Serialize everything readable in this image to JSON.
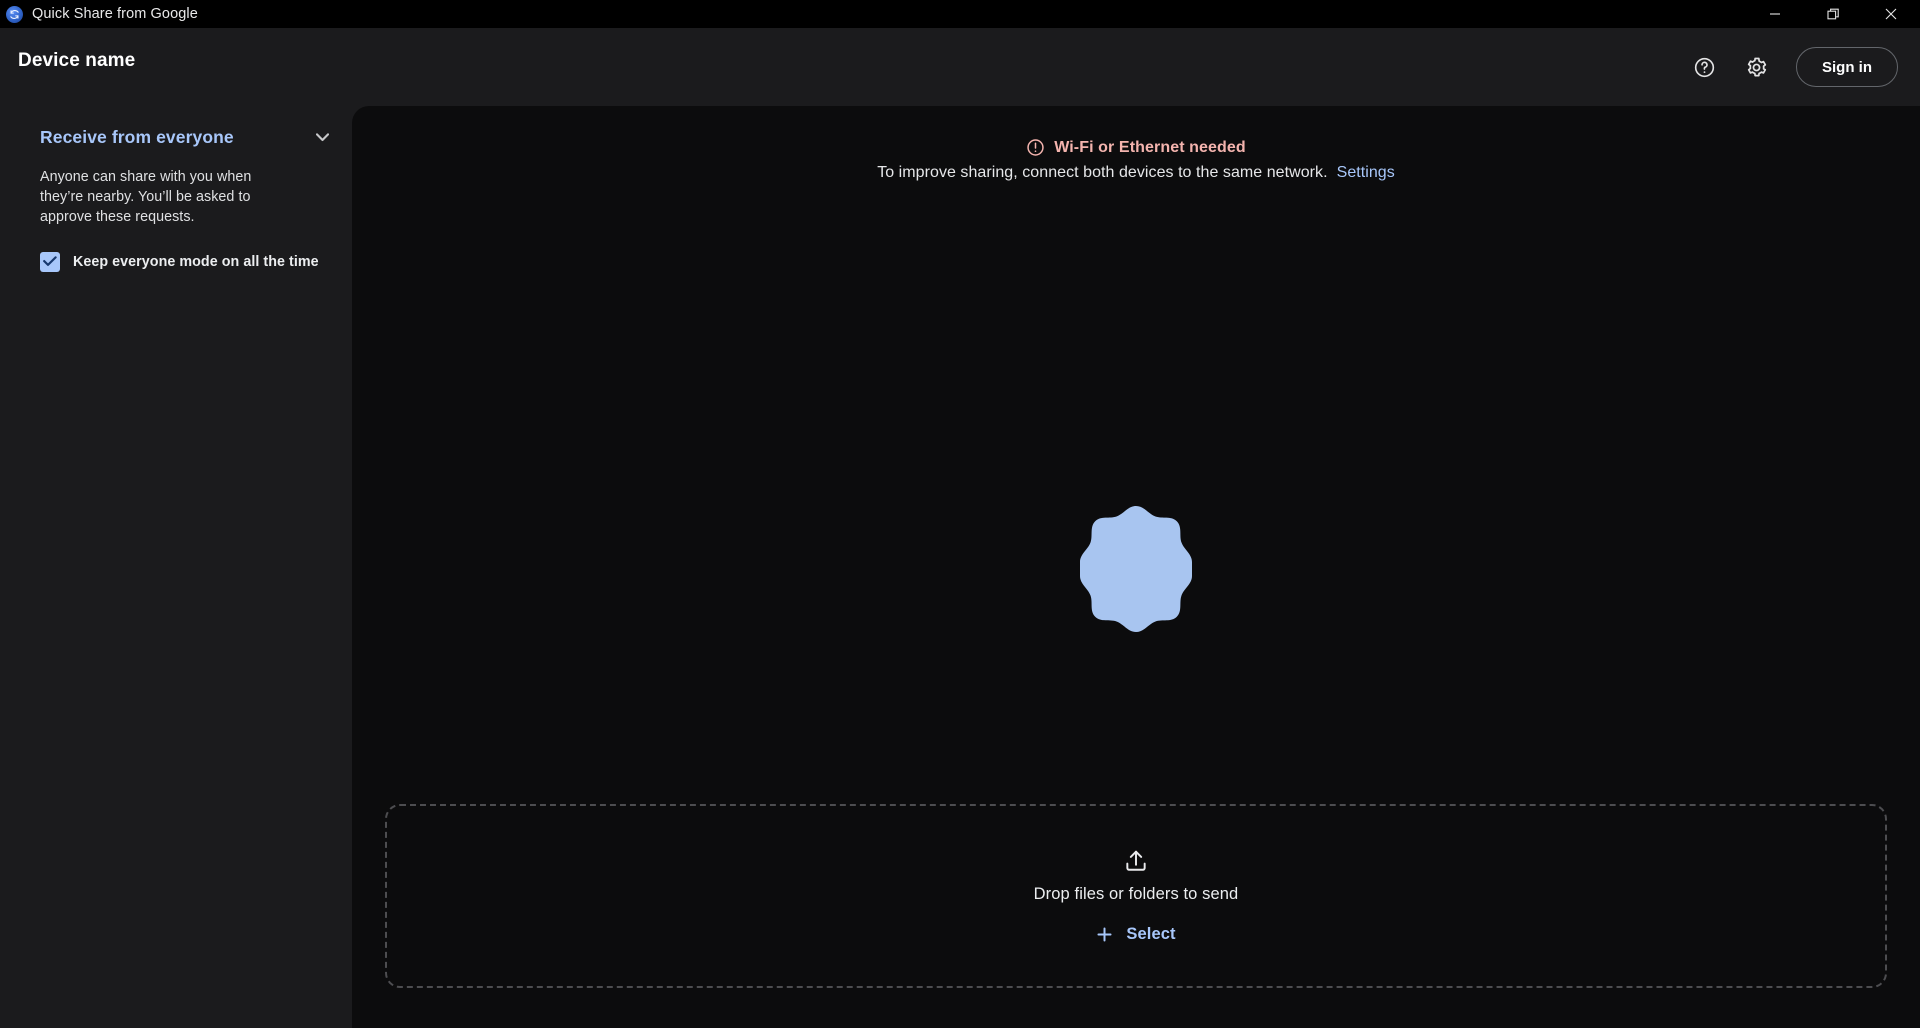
{
  "window": {
    "title": "Quick Share from Google",
    "logo_icon": "quick-share-logo-icon",
    "controls": {
      "minimize": "minimize-icon",
      "maximize": "maximize-restore-icon",
      "close": "close-icon"
    }
  },
  "header": {
    "device_name": "Device name",
    "help_icon": "help-circle-icon",
    "settings_icon": "gear-icon",
    "sign_in_label": "Sign in"
  },
  "sidebar": {
    "mode_title": "Receive from everyone",
    "chevron_icon": "chevron-down-icon",
    "mode_description": "Anyone can share with you when they’re nearby. You’ll be asked to approve these requests.",
    "keep_everyone_label": "Keep everyone mode on all the time",
    "keep_everyone_checked": true,
    "check_icon": "check-icon"
  },
  "main": {
    "notice": {
      "icon": "error-exclamation-circle-icon",
      "title": "Wi-Fi or Ethernet needed",
      "body": "To improve sharing, connect both devices to the same network.",
      "link_label": "Settings"
    },
    "visual": {
      "name": "quick-share-blob-graphic",
      "lobes": 8
    },
    "dropzone": {
      "upload_icon": "upload-icon",
      "drop_text": "Drop files or folders to send",
      "plus_icon": "plus-icon",
      "select_label": "Select"
    }
  },
  "colors": {
    "accent_blue": "#a8c7fa",
    "warning_pink": "#f4b4ae",
    "titlebar_bg": "#000000",
    "sidebar_bg": "#1b1b1d",
    "panel_bg": "#0c0c0d",
    "blob_fill": "#a8c5f0"
  }
}
